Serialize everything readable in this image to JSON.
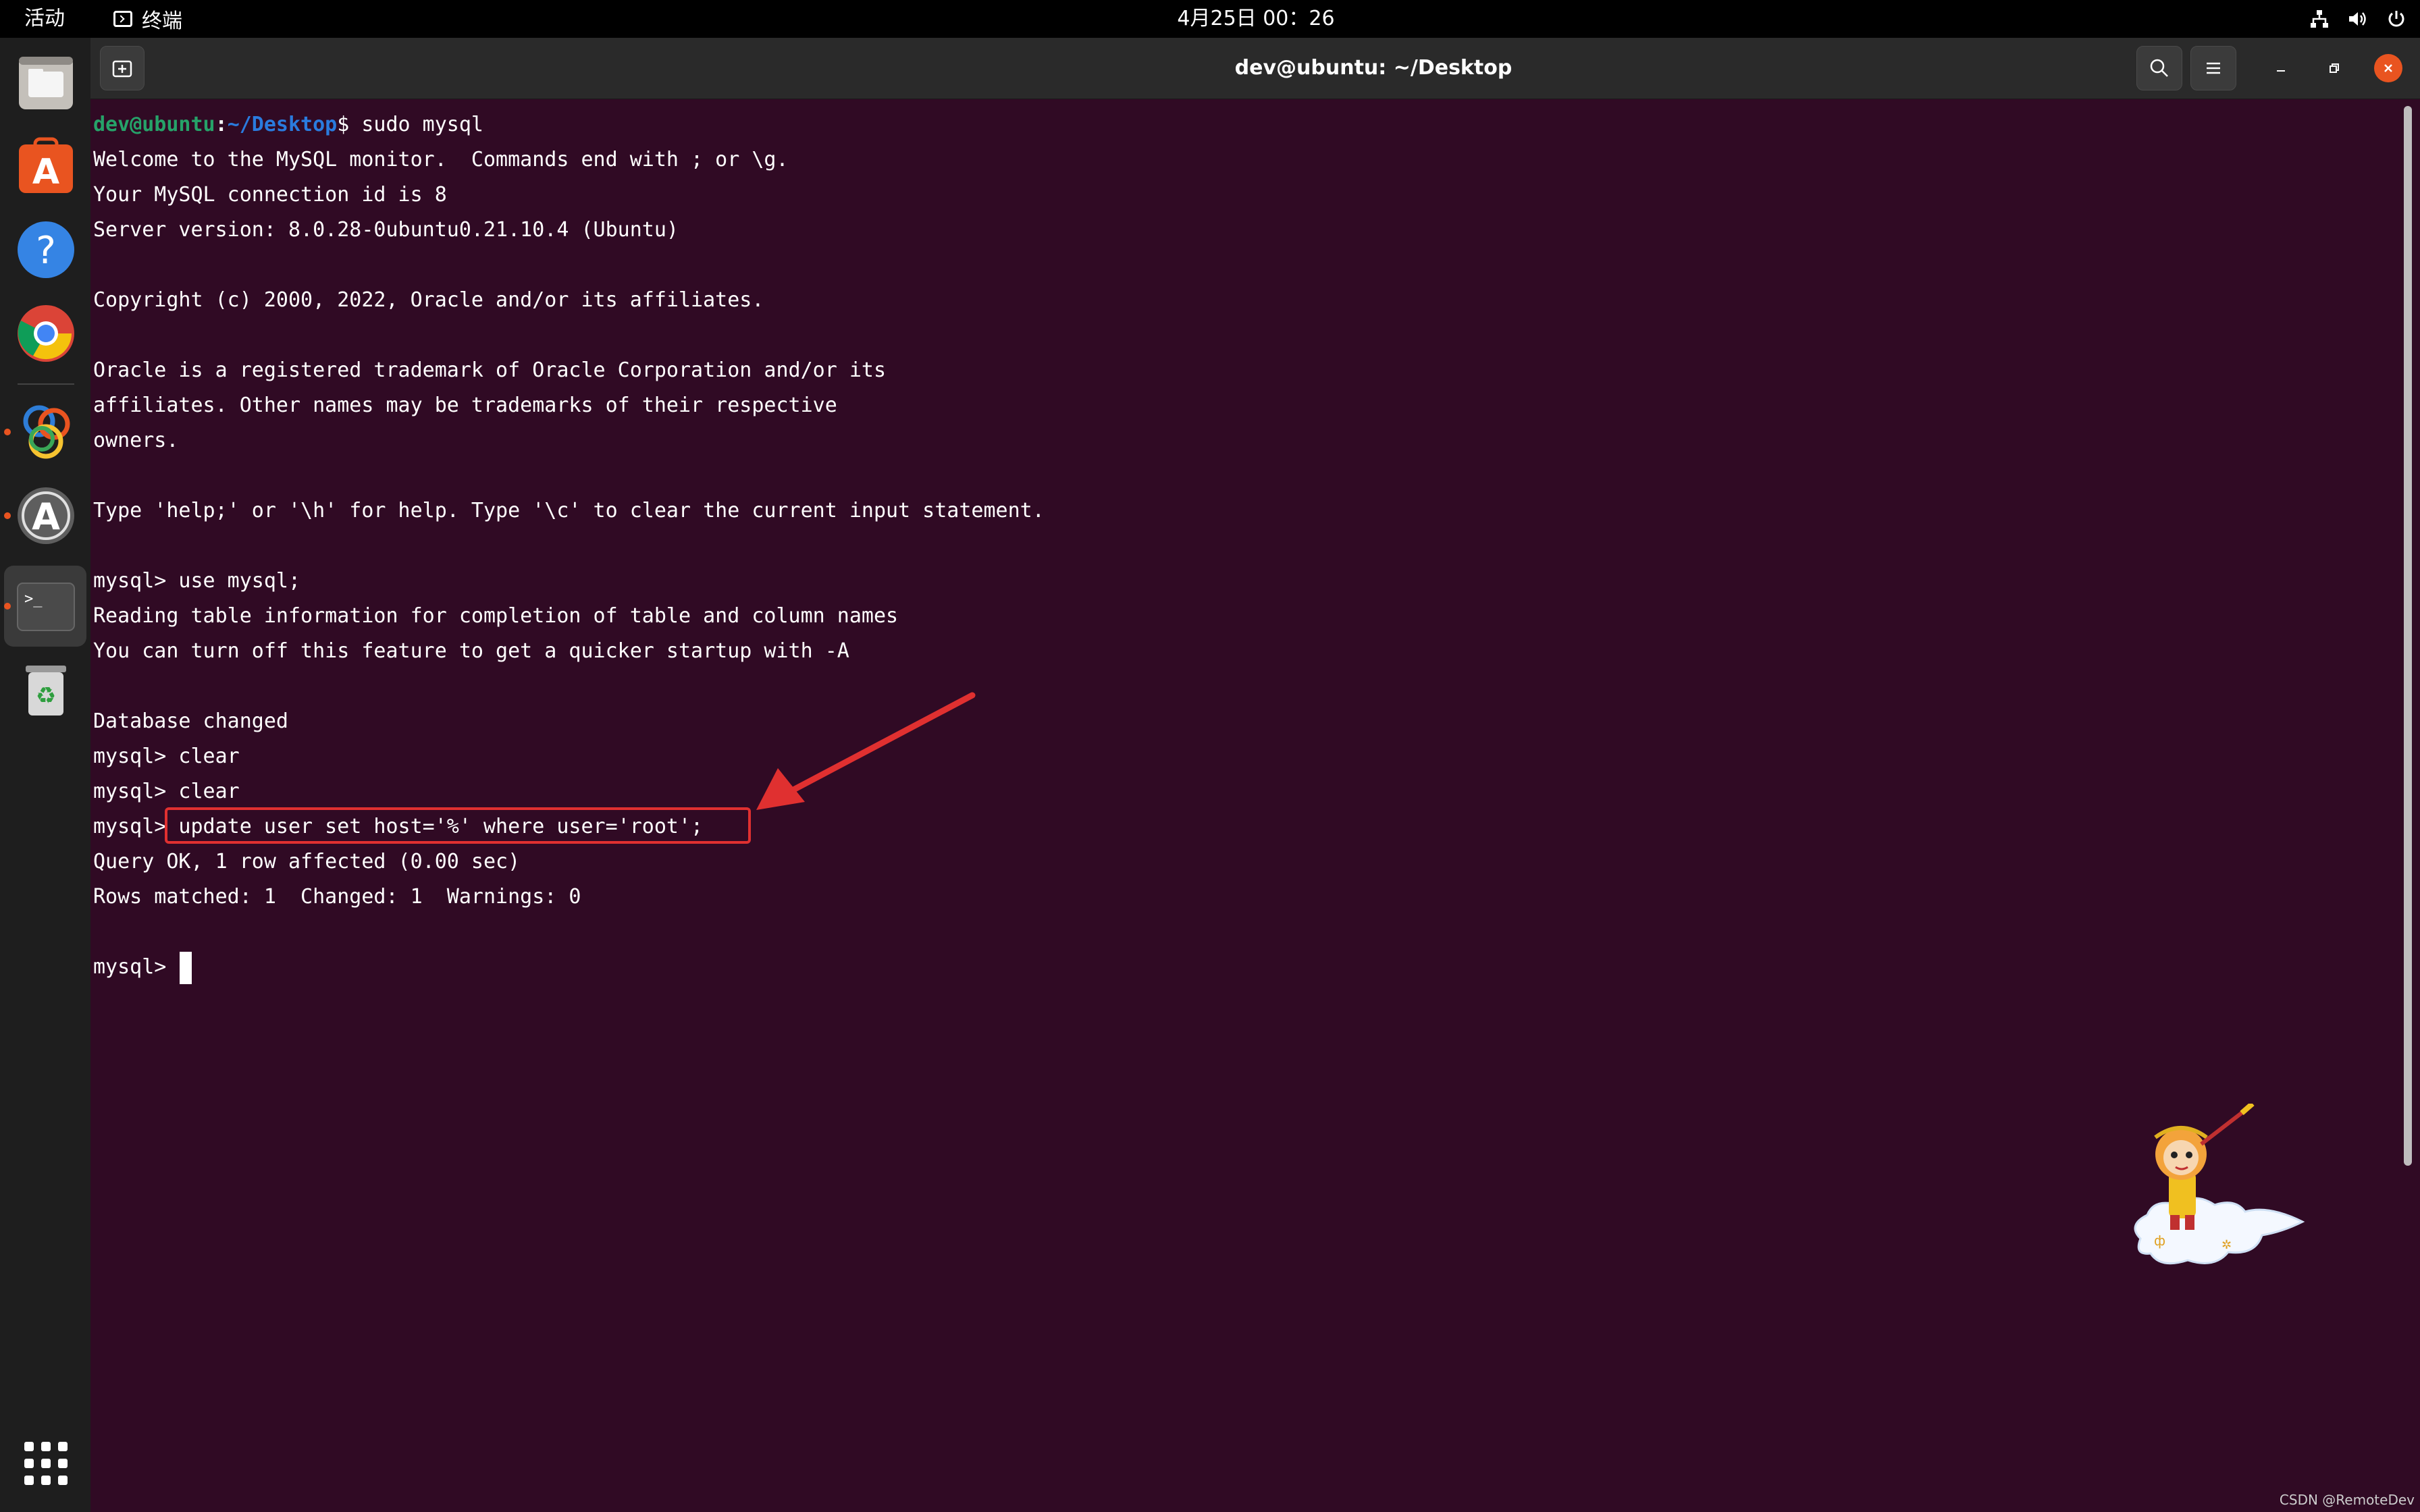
{
  "topbar": {
    "activities": "活动",
    "app_name": "终端",
    "clock": "4月25日  00：26"
  },
  "dock": {
    "items": [
      {
        "name": "files",
        "icon": "folder-icon"
      },
      {
        "name": "software",
        "icon": "app-store-icon"
      },
      {
        "name": "help",
        "icon": "help-icon"
      },
      {
        "name": "chrome",
        "icon": "chrome-icon"
      },
      {
        "name": "navicat",
        "icon": "navicat-icon"
      },
      {
        "name": "software-updater",
        "icon": "updater-icon"
      },
      {
        "name": "terminal",
        "icon": "terminal-icon"
      },
      {
        "name": "trash",
        "icon": "trash-icon"
      }
    ],
    "show_apps_icon": "grid-icon"
  },
  "window": {
    "title": "dev@ubuntu: ~/Desktop"
  },
  "terminal": {
    "prompt_user": "dev@ubuntu",
    "prompt_colon": ":",
    "prompt_path": "~/Desktop",
    "prompt_cmd": "$ sudo mysql",
    "lines": [
      "Welcome to the MySQL monitor.  Commands end with ; or \\g.",
      "Your MySQL connection id is 8",
      "Server version: 8.0.28-0ubuntu0.21.10.4 (Ubuntu)",
      "",
      "Copyright (c) 2000, 2022, Oracle and/or its affiliates.",
      "",
      "Oracle is a registered trademark of Oracle Corporation and/or its",
      "affiliates. Other names may be trademarks of their respective",
      "owners.",
      "",
      "Type 'help;' or '\\h' for help. Type '\\c' to clear the current input statement.",
      "",
      "mysql> use mysql;",
      "Reading table information for completion of table and column names",
      "You can turn off this feature to get a quicker startup with -A",
      "",
      "Database changed",
      "mysql> clear",
      "mysql> clear",
      "mysql> update user set host='%' where user='root';",
      "Query OK, 1 row affected (0.00 sec)",
      "Rows matched: 1  Changed: 1  Warnings: 0",
      ""
    ],
    "final_prompt": "mysql> "
  },
  "colors": {
    "terminal_bg": "#300a24",
    "prompt_user": "#26a269",
    "prompt_path": "#2a7bde",
    "annotation": "#e03030",
    "close_button": "#e95420"
  },
  "watermark": "CSDN @RemoteDev"
}
